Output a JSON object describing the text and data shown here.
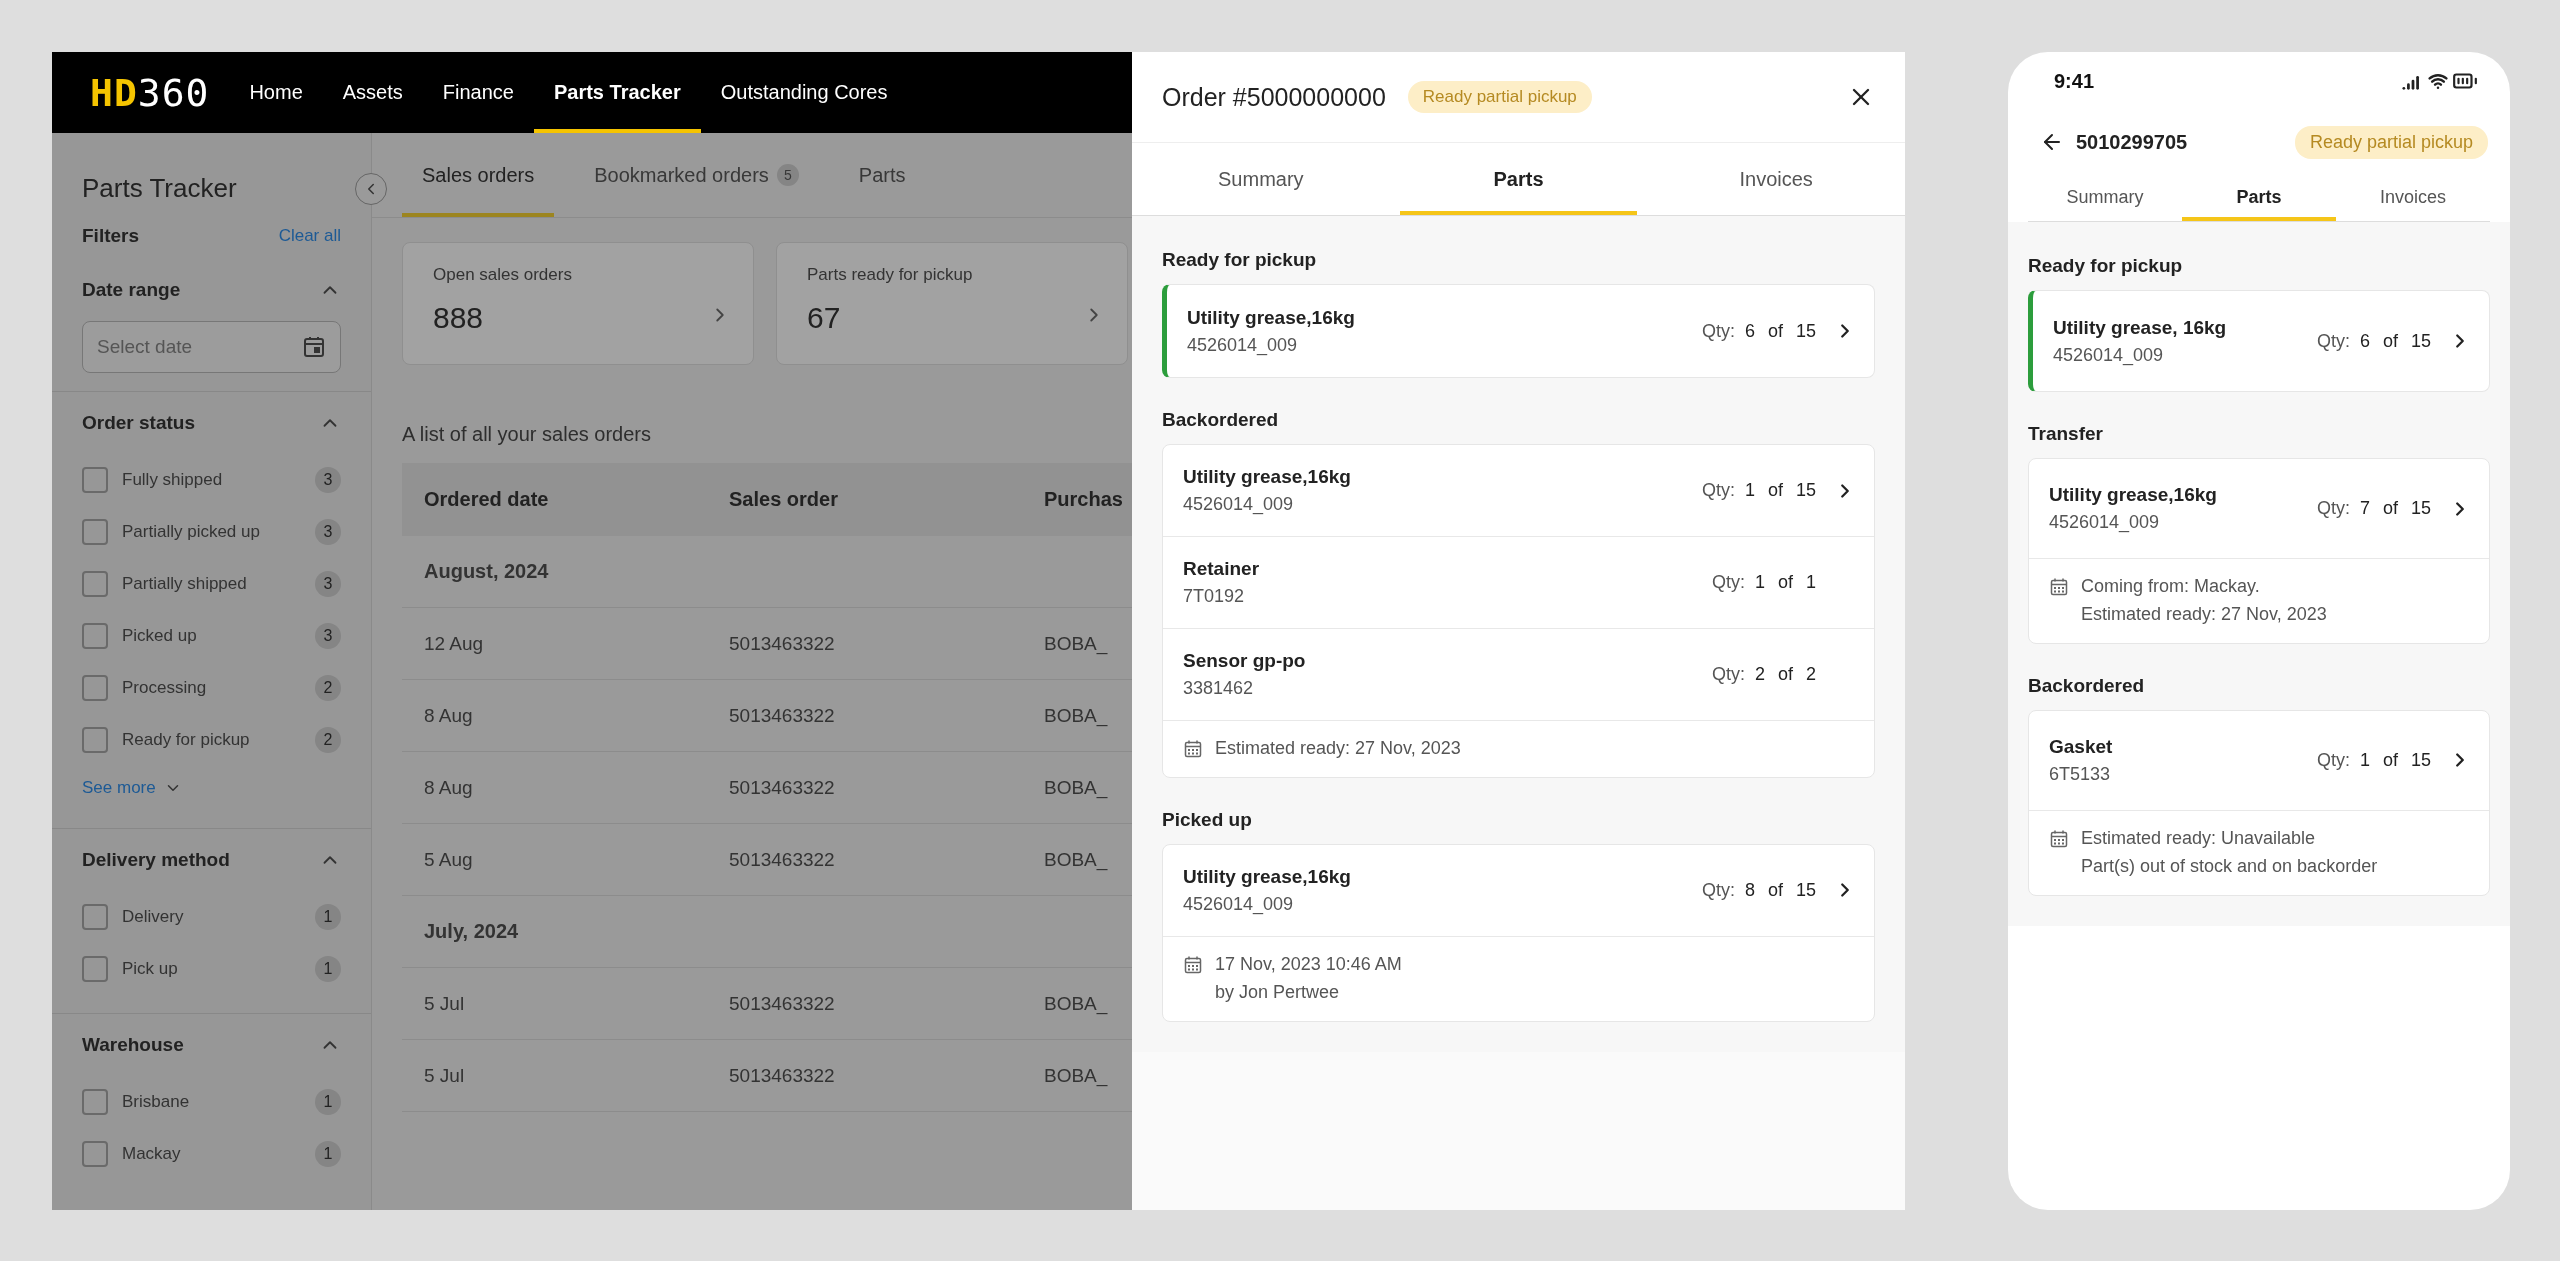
{
  "app": {
    "logo": {
      "accent": "HD",
      "rest": "360"
    },
    "nav": [
      {
        "label": "Home",
        "selected": false
      },
      {
        "label": "Assets",
        "selected": false
      },
      {
        "label": "Finance",
        "selected": false
      },
      {
        "label": "Parts Tracker",
        "selected": true
      },
      {
        "label": "Outstanding Cores",
        "selected": false
      }
    ],
    "sidebar": {
      "title": "Parts Tracker",
      "filters_label": "Filters",
      "clear_all": "Clear all",
      "groups": [
        {
          "title": "Date range",
          "expanded": true,
          "kind": "date",
          "placeholder": "Select date"
        },
        {
          "title": "Order status",
          "expanded": true,
          "kind": "checkbox",
          "see_more": "See more",
          "options": [
            {
              "label": "Fully shipped",
              "count": "3",
              "checked": false
            },
            {
              "label": "Partially picked up",
              "count": "3",
              "checked": false
            },
            {
              "label": "Partially shipped",
              "count": "3",
              "checked": false
            },
            {
              "label": "Picked up",
              "count": "3",
              "checked": false
            },
            {
              "label": "Processing",
              "count": "2",
              "checked": false
            },
            {
              "label": "Ready for pickup",
              "count": "2",
              "checked": false
            }
          ]
        },
        {
          "title": "Delivery method",
          "expanded": true,
          "kind": "checkbox",
          "options": [
            {
              "label": "Delivery",
              "count": "1",
              "checked": false
            },
            {
              "label": "Pick up",
              "count": "1",
              "checked": false
            }
          ]
        },
        {
          "title": "Warehouse",
          "expanded": true,
          "kind": "checkbox",
          "options": [
            {
              "label": "Brisbane",
              "count": "1",
              "checked": false
            },
            {
              "label": "Mackay",
              "count": "1",
              "checked": false
            }
          ]
        }
      ]
    },
    "tabs": [
      {
        "label": "Sales orders",
        "selected": true
      },
      {
        "label": "Bookmarked orders",
        "badge": "5",
        "selected": false
      },
      {
        "label": "Parts",
        "selected": false
      }
    ],
    "stats": [
      {
        "label": "Open sales orders",
        "value": "888"
      },
      {
        "label": "Parts ready for pickup",
        "value": "67"
      }
    ],
    "table": {
      "caption": "A list of all your sales orders",
      "columns": [
        "Ordered date",
        "Sales order",
        "Purchas"
      ],
      "groups": [
        {
          "title": "August, 2024",
          "rows": [
            [
              "12 Aug",
              "5013463322",
              "BOBA_"
            ],
            [
              "8 Aug",
              "5013463322",
              "BOBA_"
            ],
            [
              "8 Aug",
              "5013463322",
              "BOBA_"
            ],
            [
              "5 Aug",
              "5013463322",
              "BOBA_"
            ]
          ]
        },
        {
          "title": "July, 2024",
          "rows": [
            [
              "5 Jul",
              "5013463322",
              "BOBA_"
            ],
            [
              "5 Jul",
              "5013463322",
              "BOBA_"
            ]
          ]
        }
      ]
    }
  },
  "order_panel": {
    "title": "Order #5000000000",
    "status": "Ready partial pickup",
    "tabs": [
      {
        "label": "Summary",
        "selected": false
      },
      {
        "label": "Parts",
        "selected": true
      },
      {
        "label": "Invoices",
        "selected": false
      }
    ],
    "sections": [
      {
        "title": "Ready for pickup",
        "highlighted": true,
        "items": [
          {
            "name": "Utility grease,16kg",
            "number": "4526014_009",
            "qty_label": "Qty:",
            "qty": "6 of 15",
            "link": true
          }
        ]
      },
      {
        "title": "Backordered",
        "highlighted": false,
        "items": [
          {
            "name": "Utility grease,16kg",
            "number": "4526014_009",
            "qty_label": "Qty:",
            "qty": "1 of 15",
            "link": true
          },
          {
            "name": "Retainer",
            "number": "7T0192",
            "qty_label": "Qty:",
            "qty": "1 of 1",
            "link": false
          },
          {
            "name": "Sensor gp-po",
            "number": "3381462",
            "qty_label": "Qty:",
            "qty": "2 of 2",
            "link": false
          }
        ],
        "note": [
          "Estimated ready: 27 Nov, 2023"
        ]
      },
      {
        "title": "Picked up",
        "highlighted": false,
        "items": [
          {
            "name": "Utility grease,16kg",
            "number": "4526014_009",
            "qty_label": "Qty:",
            "qty": "8 of 15",
            "link": true
          }
        ],
        "note": [
          "17 Nov, 2023 10:46 AM",
          "by Jon Pertwee"
        ]
      }
    ]
  },
  "mobile": {
    "time": "9:41",
    "title": "5010299705",
    "status": "Ready partial pickup",
    "tabs": [
      {
        "label": "Summary",
        "selected": false
      },
      {
        "label": "Parts",
        "selected": true
      },
      {
        "label": "Invoices",
        "selected": false
      }
    ],
    "sections": [
      {
        "title": "Ready for pickup",
        "highlighted": true,
        "items": [
          {
            "name": "Utility grease, 16kg",
            "number": "4526014_009",
            "qty_label": "Qty:",
            "qty": "6 of 15",
            "link": true
          }
        ]
      },
      {
        "title": "Transfer",
        "highlighted": false,
        "items": [
          {
            "name": "Utility grease,16kg",
            "number": "4526014_009",
            "qty_label": "Qty:",
            "qty": "7 of 15",
            "link": true
          }
        ],
        "note": [
          "Coming from: Mackay.",
          "Estimated ready: 27 Nov, 2023"
        ]
      },
      {
        "title": "Backordered",
        "highlighted": false,
        "items": [
          {
            "name": "Gasket",
            "number": "6T5133",
            "qty_label": "Qty:",
            "qty": "1 of 15",
            "link": true
          }
        ],
        "note": [
          "Estimated ready: Unavailable",
          "Part(s) out of stock and on backorder"
        ]
      }
    ]
  }
}
